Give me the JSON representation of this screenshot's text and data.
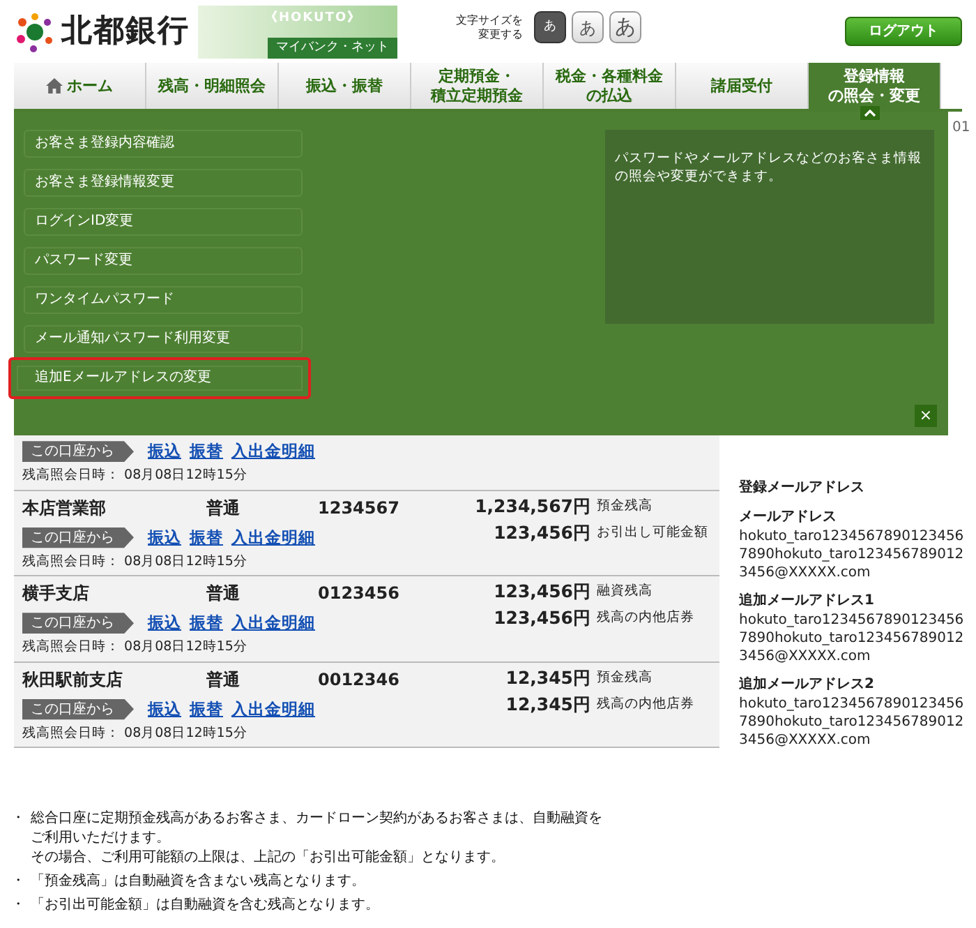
{
  "header": {
    "bank_name": "北都銀行",
    "banner_top": "《HOKUTO》",
    "banner_bottom": "マイバンク・ネット",
    "font_size_label": [
      "文字サイズを",
      "変更する"
    ],
    "font_sizes": [
      {
        "label": "あ",
        "selected": true
      },
      {
        "label": "あ",
        "selected": false
      },
      {
        "label": "あ",
        "selected": false
      }
    ],
    "logout": "ログアウト"
  },
  "nav": [
    {
      "lines": [
        "ホーム"
      ],
      "kind": "home",
      "selected": false
    },
    {
      "lines": [
        "残高・明細照会"
      ],
      "kind": "text",
      "selected": false
    },
    {
      "lines": [
        "振込・振替"
      ],
      "kind": "text",
      "selected": false
    },
    {
      "lines": [
        "定期預金・",
        "積立定期預金"
      ],
      "kind": "text",
      "selected": false
    },
    {
      "lines": [
        "税金・各種料金",
        "の払込"
      ],
      "kind": "text",
      "selected": false
    },
    {
      "lines": [
        "諸届受付"
      ],
      "kind": "text",
      "selected": false
    },
    {
      "lines": [
        "登録情報",
        "の照会・変更"
      ],
      "kind": "text",
      "selected": true
    }
  ],
  "menu": {
    "items": [
      {
        "label": "お客さま登録内容確認",
        "highlighted": false
      },
      {
        "label": "お客さま登録情報変更",
        "highlighted": false
      },
      {
        "label": "ログインID変更",
        "highlighted": false
      },
      {
        "label": "パスワード変更",
        "highlighted": false
      },
      {
        "label": "ワンタイムパスワード",
        "highlighted": false
      },
      {
        "label": "メール通知パスワード利用変更",
        "highlighted": false
      },
      {
        "label": "追加Eメールアドレスの変更",
        "highlighted": true
      }
    ],
    "description": "パスワードやメールアドレスなどのお客さま情報の照会や変更ができます。",
    "close": "×"
  },
  "peek_text": "01",
  "accounts": [
    {
      "from_label": "この口座から",
      "links": [
        "振込",
        "振替",
        "入出金明細"
      ],
      "date": "残高照会日時： 08月08日12時15分"
    },
    {
      "branch": "本店営業部",
      "type": "普通",
      "number": "1234567",
      "amounts": [
        {
          "value": "1,234,567円",
          "label": "預金残高"
        },
        {
          "value": "123,456円",
          "label": "お引出し可能金額"
        }
      ],
      "from_label": "この口座から",
      "links": [
        "振込",
        "振替",
        "入出金明細"
      ],
      "date": "残高照会日時： 08月08日12時15分"
    },
    {
      "branch": "横手支店",
      "type": "普通",
      "number": "0123456",
      "amounts": [
        {
          "value": "123,456円",
          "label": "融資残高"
        },
        {
          "value": "123,456円",
          "label": "残高の内他店券"
        }
      ],
      "from_label": "この口座から",
      "links": [
        "振込",
        "振替",
        "入出金明細"
      ],
      "date": "残高照会日時： 08月08日12時15分"
    },
    {
      "branch": "秋田駅前支店",
      "type": "普通",
      "number": "0012346",
      "amounts": [
        {
          "value": "12,345円",
          "label": "預金残高"
        },
        {
          "value": "12,345円",
          "label": "残高の内他店券"
        }
      ],
      "from_label": "この口座から",
      "links": [
        "振込",
        "振替",
        "入出金明細"
      ],
      "date": "残高照会日時： 08月08日12時15分"
    }
  ],
  "emails": {
    "title": "登録メールアドレス",
    "entries": [
      {
        "label": "メールアドレス",
        "lines": [
          "hokuto_taro1234567890123456",
          "7890hokuto_taro123456789012",
          "3456@XXXXX.com"
        ]
      },
      {
        "label": "追加メールアドレス1",
        "lines": [
          "hokuto_taro1234567890123456",
          "7890hokuto_taro123456789012",
          "3456@XXXXX.com"
        ]
      },
      {
        "label": "追加メールアドレス2",
        "lines": [
          "hokuto_taro1234567890123456",
          "7890hokuto_taro123456789012",
          "3456@XXXXX.com"
        ]
      }
    ]
  },
  "notes": [
    {
      "marker": "・",
      "lines": [
        "総合口座に定期預金残高があるお客さま、カードローン契約があるお客さまは、自動融資を",
        "ご利用いただけます。",
        "その場合、ご利用可能額の上限は、上記の「お引出可能金額」となります。"
      ]
    },
    {
      "marker": "・",
      "lines": [
        "「預金残高」は自動融資を含まない残高となります。"
      ]
    },
    {
      "marker": "・",
      "lines": [
        "「お引出可能金額」は自動融資を含む残高となります。"
      ]
    }
  ]
}
